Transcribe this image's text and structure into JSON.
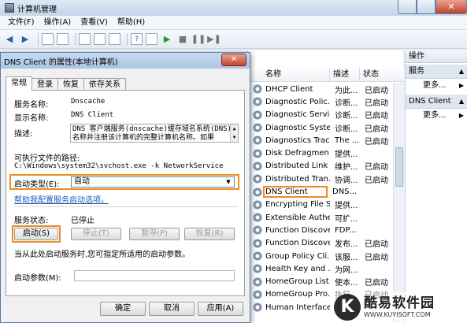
{
  "window": {
    "title": "计算机管理",
    "close_glyph": "✕"
  },
  "menu": [
    "文件(F)",
    "操作(A)",
    "查看(V)",
    "帮助(H)"
  ],
  "toolbar": {
    "icons": [
      "back-arrow-icon",
      "forward-arrow-icon",
      "folder-up-icon",
      "tree-icon",
      "properties-icon",
      "refresh-icon",
      "export-icon",
      "help-icon",
      "console-icon",
      "play-icon",
      "stop-icon",
      "pause-icon",
      "restart-icon"
    ],
    "glyphs": {
      "back": "◀",
      "forward": "▶",
      "play": "▶",
      "stop": "■",
      "pause": "❚❚",
      "restart": "▶❚",
      "help": "?"
    }
  },
  "services_list": {
    "columns": {
      "name": "名称",
      "desc": "描述",
      "status": "状态"
    },
    "rows": [
      {
        "name": "DHCP Client",
        "desc": "为此...",
        "status": "已启动"
      },
      {
        "name": "Diagnostic Polic...",
        "desc": "诊断...",
        "status": "已启动"
      },
      {
        "name": "Diagnostic Servi...",
        "desc": "诊断...",
        "status": "已启动"
      },
      {
        "name": "Diagnostic Syste...",
        "desc": "诊断...",
        "status": "已启动"
      },
      {
        "name": "Diagnostics Trac...",
        "desc": "The ...",
        "status": "已启动"
      },
      {
        "name": "Disk Defragmen...",
        "desc": "提供...",
        "status": ""
      },
      {
        "name": "Distributed Link ...",
        "desc": "维护...",
        "status": "已启动"
      },
      {
        "name": "Distributed Tran...",
        "desc": "协调...",
        "status": "已启动"
      },
      {
        "name": "DNS Client",
        "desc": "DNS...",
        "status": ""
      },
      {
        "name": "Encrypting File S...",
        "desc": "提供...",
        "status": ""
      },
      {
        "name": "Extensible Authe...",
        "desc": "可扩...",
        "status": ""
      },
      {
        "name": "Function Discove...",
        "desc": "FDP...",
        "status": ""
      },
      {
        "name": "Function Discove...",
        "desc": "发布...",
        "status": "已启动"
      },
      {
        "name": "Group Policy Cli...",
        "desc": "该服...",
        "status": "已启动"
      },
      {
        "name": "Health Key and ...",
        "desc": "为网...",
        "status": ""
      },
      {
        "name": "HomeGroup List...",
        "desc": "使本...",
        "status": "已启动"
      },
      {
        "name": "HomeGroup Pro...",
        "desc": "执行...",
        "status": "已启动"
      },
      {
        "name": "Human Interface...",
        "desc": "启用...",
        "status": ""
      }
    ],
    "highlighted_index": 8
  },
  "actions_pane": {
    "header": "操作",
    "sections": [
      {
        "title": "服务",
        "more": "更多..."
      },
      {
        "title": "DNS Client",
        "more": "更多..."
      }
    ],
    "collapse_glyph": "▲",
    "more_glyph": "▶"
  },
  "dialog": {
    "title": "DNS Client 的属性(本地计算机)",
    "close": "✕",
    "tabs": [
      "常规",
      "登录",
      "恢复",
      "依存关系"
    ],
    "service_name_label": "服务名称:",
    "service_name": "Dnscache",
    "display_name_label": "显示名称:",
    "display_name": "DNS Client",
    "description_label": "描述:",
    "description": "DNS 客户端服务(dnscache)缓存域名系统(DNS)名称并注册该计算机的完整计算机名称。如果",
    "exe_path_label": "可执行文件的路径:",
    "exe_path": "C:\\Windows\\system32\\svchost.exe -k NetworkService",
    "startup_type_label": "启动类型(E):",
    "startup_type": "自动",
    "help_link": "帮助我配置服务启动选项。",
    "status_label": "服务状态:",
    "status_value": "已停止",
    "buttons": {
      "start": "启动(S)",
      "stop": "停止(T)",
      "pause": "暂停(P)",
      "resume": "恢复(R)"
    },
    "hint": "当从此处启动服务时,您可指定所适用的启动参数。",
    "params_label": "启动参数(M):",
    "params_value": "",
    "ok": "确定",
    "cancel": "取消",
    "apply": "应用(A)"
  },
  "watermark": {
    "logo": "K",
    "name": "酷易软件园",
    "url": "WWW.KUYISOFT.COM"
  }
}
